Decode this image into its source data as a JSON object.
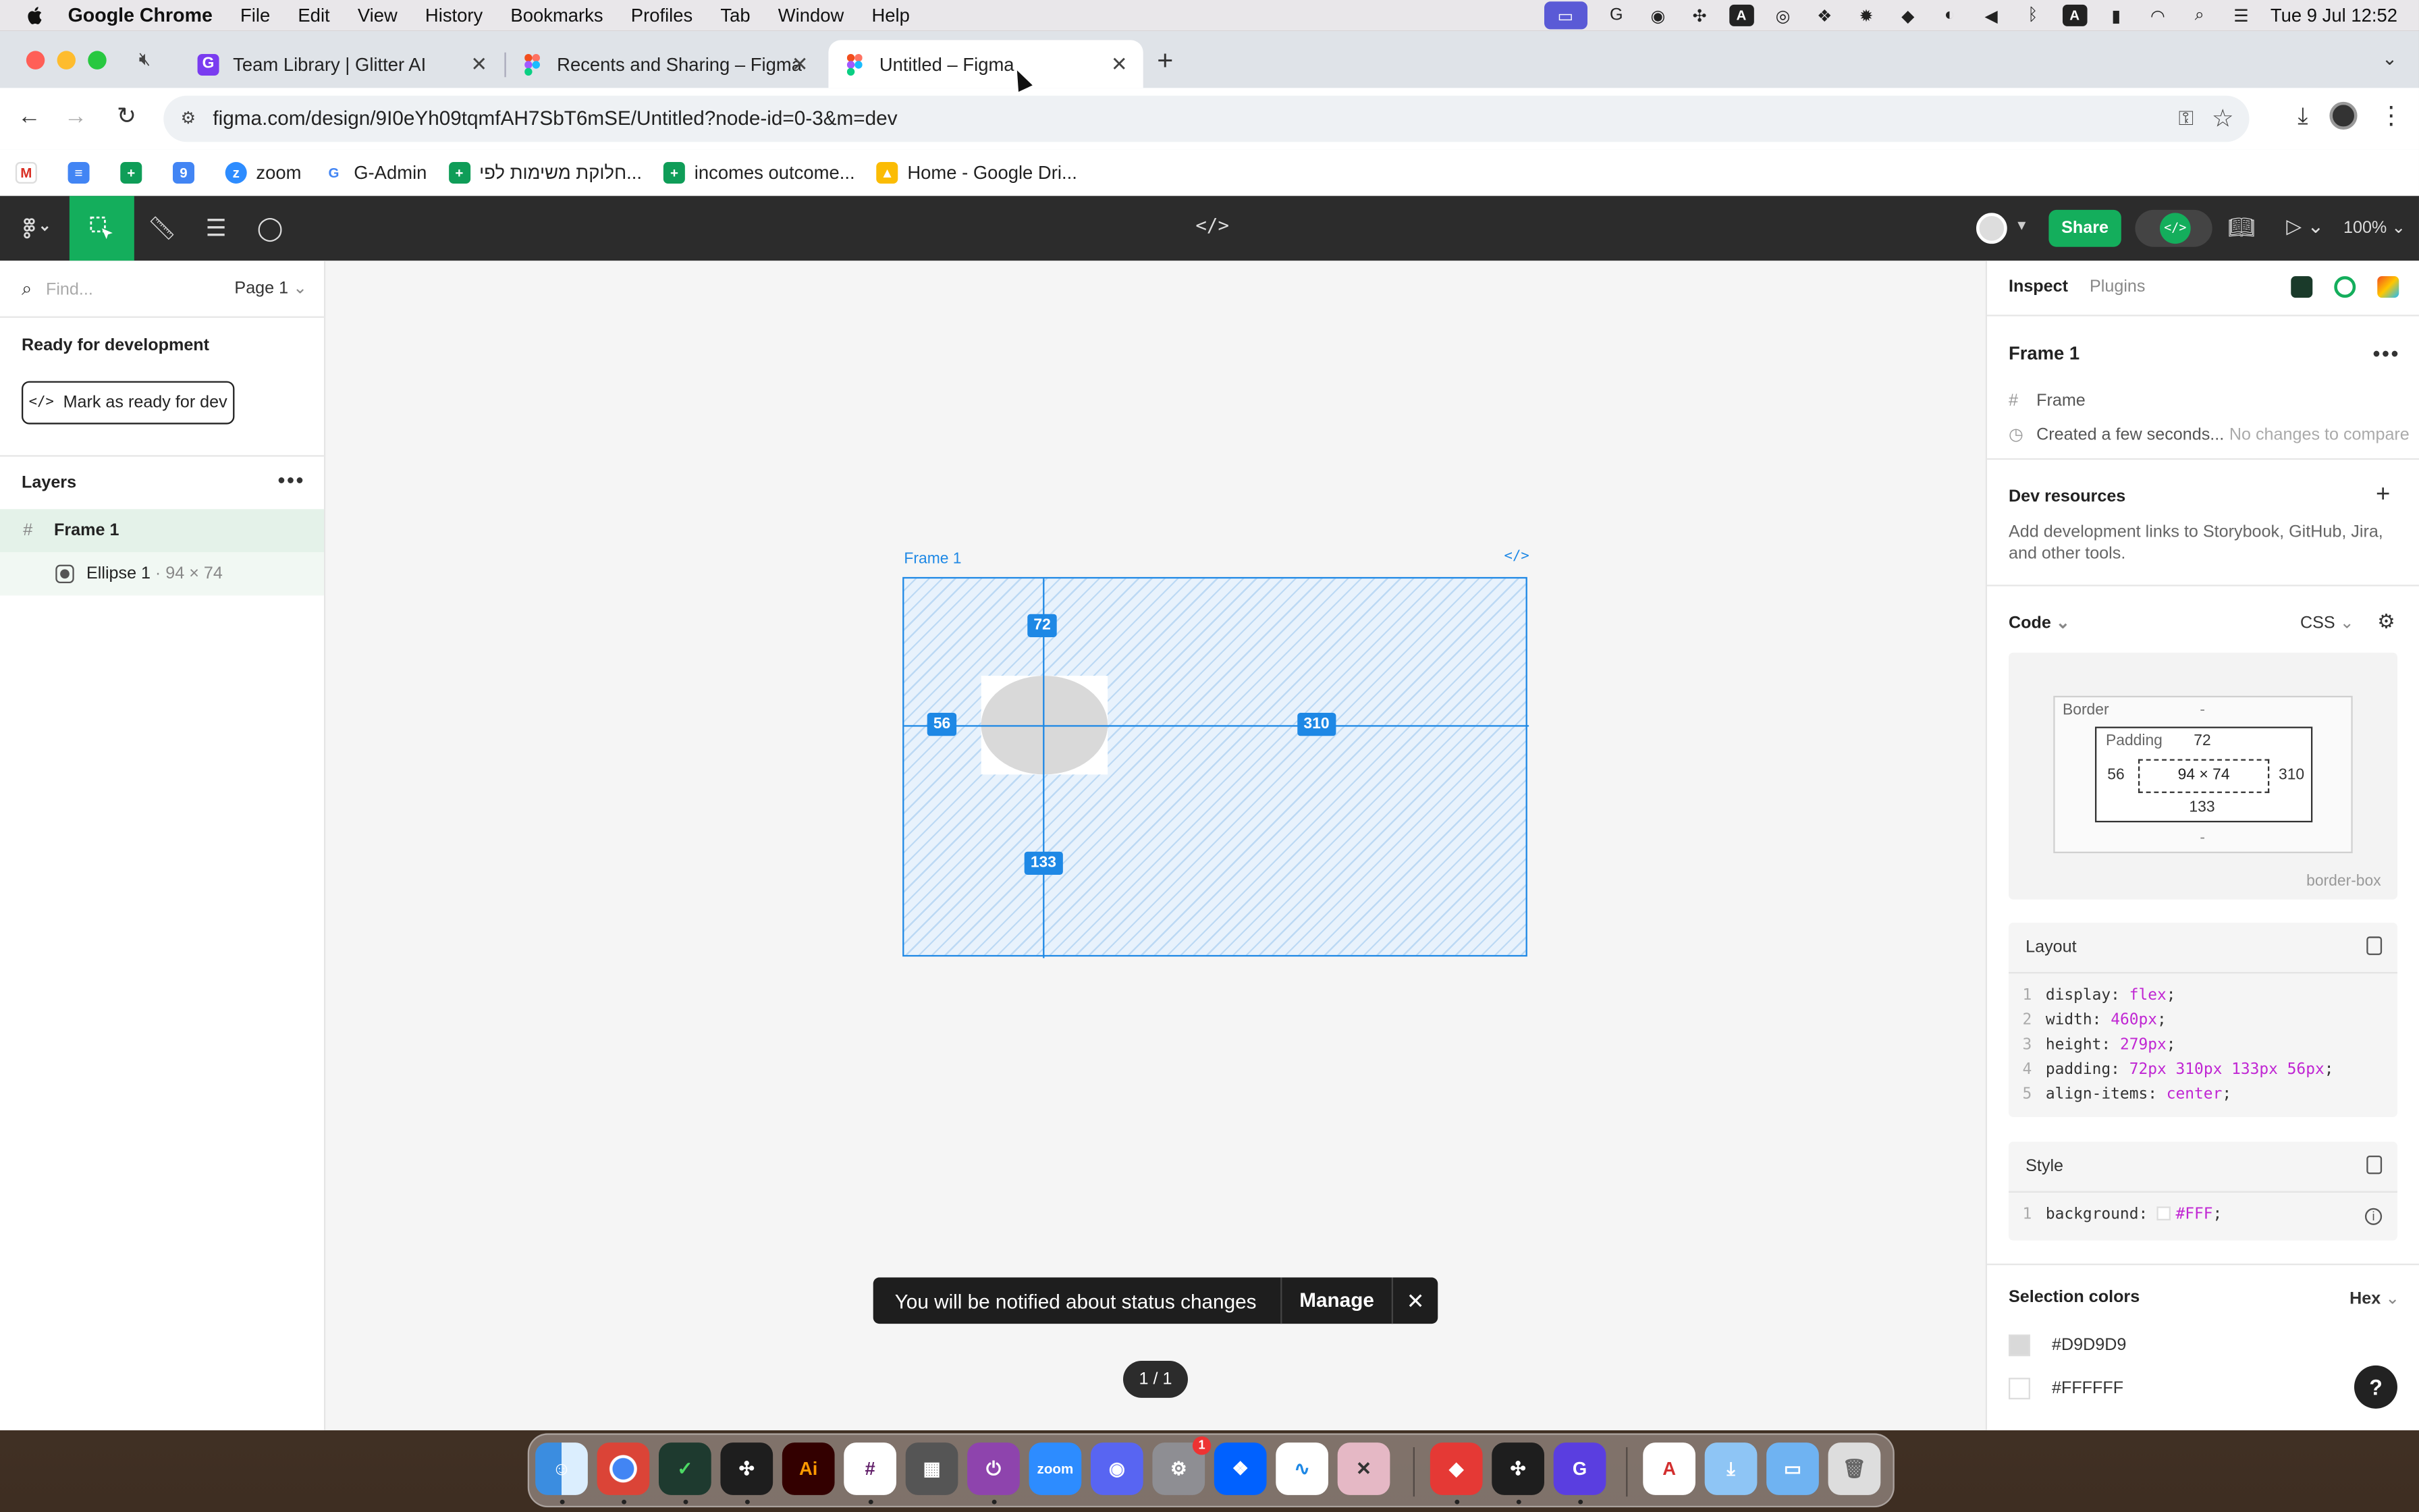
{
  "menubar": {
    "app": "Google Chrome",
    "items": [
      "File",
      "Edit",
      "View",
      "History",
      "Bookmarks",
      "Profiles",
      "Tab",
      "Window",
      "Help"
    ],
    "datetime": "Tue 9 Jul  12:52"
  },
  "browser": {
    "tabs": [
      {
        "title": "Team Library | Glitter AI",
        "active": false
      },
      {
        "title": "Recents and Sharing – Figma",
        "active": false
      },
      {
        "title": "Untitled – Figma",
        "active": true
      }
    ],
    "url": "figma.com/design/9I0eYh09tqmfAH7SbT6mSE/Untitled?node-id=0-3&m=dev",
    "bookmarks": [
      "zoom",
      "G-Admin",
      "חלוקת משימות לפי...",
      "incomes outcome...",
      "Home - Google Dri..."
    ]
  },
  "figma": {
    "topbar": {
      "share_label": "Share",
      "zoom_label": "100%"
    },
    "left": {
      "search_placeholder": "Find...",
      "page_label": "Page 1",
      "ready_title": "Ready for development",
      "mark_ready_label": "Mark as ready for dev",
      "layers_title": "Layers",
      "layers": [
        {
          "name": "Frame 1",
          "dims": ""
        },
        {
          "name": "Ellipse 1",
          "dims": "· 94 × 74"
        }
      ]
    },
    "canvas": {
      "frame_label": "Frame 1",
      "measure_top": "72",
      "measure_left": "56",
      "measure_right": "310",
      "measure_bottom": "133",
      "toast_message": "You will be notified about status changes",
      "toast_action": "Manage",
      "pager": "1 / 1"
    },
    "right": {
      "tab_inspect": "Inspect",
      "tab_plugins": "Plugins",
      "selection_name": "Frame 1",
      "selection_type": "Frame",
      "created": "Created a few seconds...",
      "no_changes": "No changes to compare",
      "dev_resources_title": "Dev resources",
      "dev_resources_desc": "Add development links to Storybook, GitHub, Jira, and other tools.",
      "code_title": "Code",
      "code_lang": "CSS",
      "box_model": {
        "border_label": "Border",
        "padding_label": "Padding",
        "padding_top": "72",
        "padding_left": "56",
        "padding_right": "310",
        "padding_bottom": "133",
        "content": "94 × 74",
        "dash": "-",
        "sizing": "border-box"
      },
      "layout_title": "Layout",
      "layout_code": [
        {
          "n": "1",
          "prop": "display:",
          "val": "flex",
          "end": ";"
        },
        {
          "n": "2",
          "prop": "width:",
          "val": "460px",
          "end": ";"
        },
        {
          "n": "3",
          "prop": "height:",
          "val": "279px",
          "end": ";"
        },
        {
          "n": "4",
          "prop": "padding:",
          "val": "72px 310px 133px 56px",
          "end": ";"
        },
        {
          "n": "5",
          "prop": "align-items:",
          "val": "center",
          "end": ";"
        }
      ],
      "style_title": "Style",
      "style_code": {
        "n": "1",
        "prop": "background:",
        "val": "#FFF",
        "end": ";"
      },
      "selection_colors_title": "Selection colors",
      "color_format": "Hex",
      "selection_colors": [
        "#D9D9D9",
        "#FFFFFF"
      ],
      "help": "?"
    }
  },
  "colors": {
    "figma_green": "#14ae5c",
    "selection_blue": "#1e88e5",
    "ellipse_fill": "#D9D9D9"
  }
}
